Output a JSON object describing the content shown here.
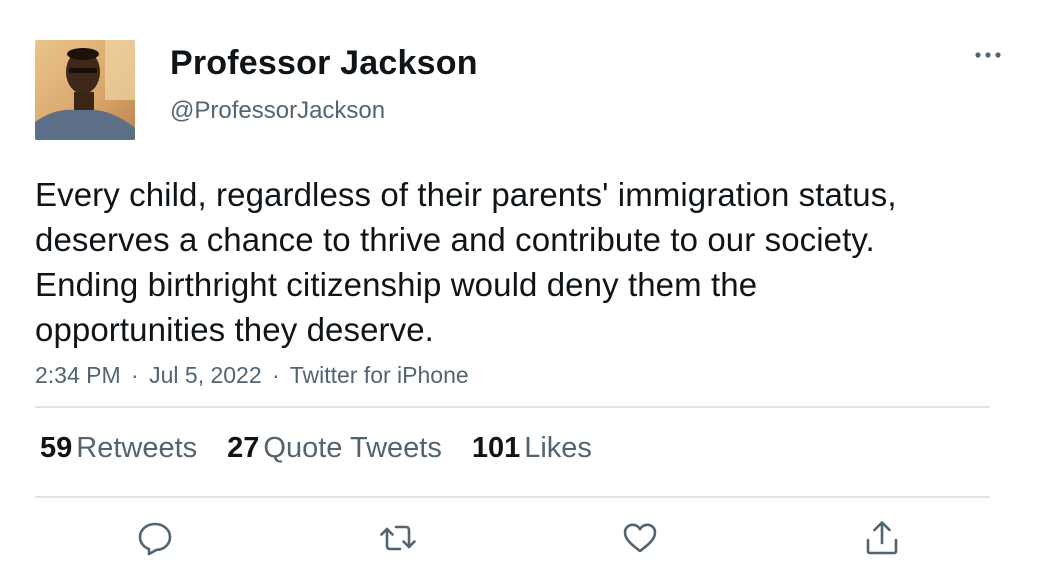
{
  "tweet": {
    "author": {
      "display_name": "Professor Jackson",
      "handle": "@ProfessorJackson"
    },
    "text": "Every child, regardless of their parents' immigration status, deserves a chance to thrive and contribute to our society. Ending birthright citizenship would deny them the opportunities they deserve.",
    "time": "2:34 PM",
    "date": "Jul 5, 2022",
    "source": "Twitter for iPhone",
    "separator": "·",
    "stats": {
      "retweets": {
        "count": "59",
        "label": "Retweets"
      },
      "quote_tweets": {
        "count": "27",
        "label": "Quote Tweets"
      },
      "likes": {
        "count": "101",
        "label": "Likes"
      }
    },
    "actions": [
      "reply-icon",
      "retweet-icon",
      "like-icon",
      "share-icon"
    ]
  },
  "colors": {
    "text_primary": "#0f1419",
    "text_secondary": "#536471",
    "divider": "#e1e4e6",
    "icon": "#536471"
  }
}
